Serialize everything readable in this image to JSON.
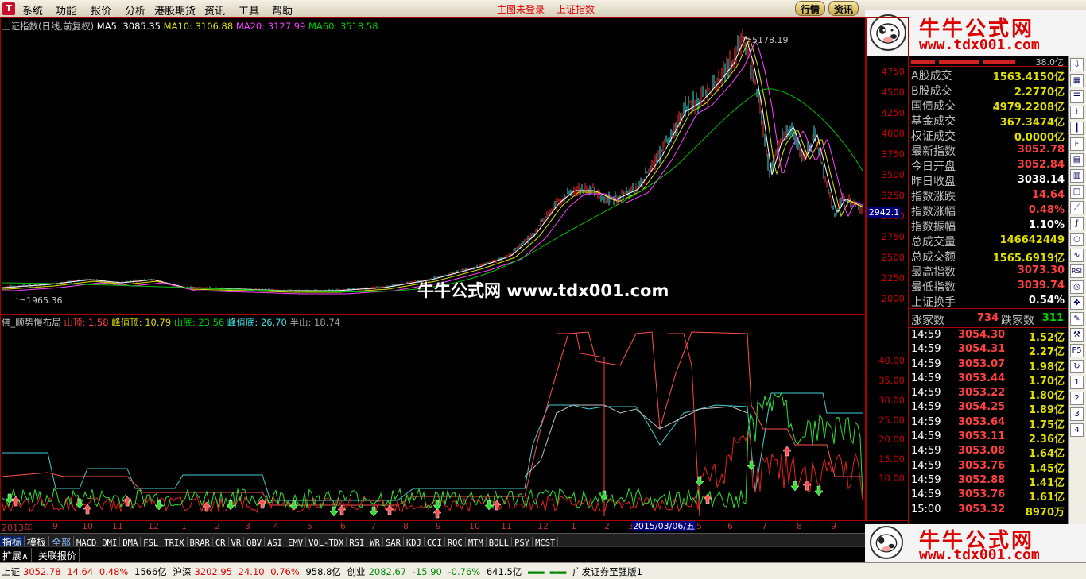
{
  "menu": [
    "系统",
    "功能",
    "报价",
    "分析",
    "港股期货",
    "资讯",
    "工具",
    "帮助"
  ],
  "center_links": [
    "主图未登录",
    "上证指数"
  ],
  "top_buttons": [
    "行情",
    "资讯"
  ],
  "brand": {
    "title": "牛牛公式网",
    "url": "www.tdx001.com"
  },
  "watermark": "牛牛公式网 www.tdx001.com",
  "chart_header": {
    "name": "上证指数(日线,前复权)",
    "ma5": "MA5: 3085.35",
    "ma10": "MA10: 3106.88",
    "ma20": "MA20: 3127.99",
    "ma60": "MA60: 3518.58"
  },
  "indicator_header": {
    "name": "佛_顺势慢布局",
    "p1": "山顶: 1.58",
    "p2": "峰值顶: 10.79",
    "p3": "山底: 23.56",
    "p4": "峰值底: 26.70",
    "p5": "半山: 18.74"
  },
  "annotations": {
    "high": "5178.19",
    "low": "1965.36",
    "current": "2942.1",
    "date": "2015/03/06/五"
  },
  "price_axis": [
    "4750",
    "4500",
    "4250",
    "4000",
    "3750",
    "3500",
    "3250",
    "3000",
    "2750",
    "2500",
    "2250",
    "2000"
  ],
  "ind_axis": [
    "40.00",
    "35.00",
    "30.00",
    "25.00",
    "20.00",
    "15.00",
    "10.00"
  ],
  "x_axis": [
    "2013年",
    "9",
    "10",
    "11",
    "12",
    "1",
    "2",
    "3",
    "4",
    "5",
    "6",
    "7",
    "8",
    "9",
    "10",
    "11",
    "12",
    "1",
    "2",
    "3",
    "5",
    "6",
    "7",
    "8",
    "9"
  ],
  "tabs_row1": [
    "指标",
    "模板",
    "全部",
    "MACD",
    "DMI",
    "DMA",
    "FSL",
    "TRIX",
    "BRAR",
    "CR",
    "VR",
    "OBV",
    "ASI",
    "EMV",
    "VOL-TDX",
    "RSI",
    "WR",
    "SAR",
    "KDJ",
    "CCI",
    "ROC",
    "MTM",
    "BOLL",
    "PSY",
    "MCST"
  ],
  "tabs_row2": [
    "扩展∧",
    "关联报价"
  ],
  "right_panel": {
    "top_value": "38.0亿",
    "stats": [
      {
        "k": "A股成交",
        "v": "1563.4150亿",
        "c": "#e0e000"
      },
      {
        "k": "B股成交",
        "v": "2.2770亿",
        "c": "#e0e000"
      },
      {
        "k": "国债成交",
        "v": "4979.2208亿",
        "c": "#e0e000"
      },
      {
        "k": "基金成交",
        "v": "367.3474亿",
        "c": "#e0e000"
      },
      {
        "k": "权证成交",
        "v": "0.0000亿",
        "c": "#e0e000"
      },
      {
        "k": "最新指数",
        "v": "3052.78",
        "c": "#ff4040"
      },
      {
        "k": "今日开盘",
        "v": "3052.84",
        "c": "#ff4040"
      },
      {
        "k": "昨日收盘",
        "v": "3038.14",
        "c": "#ffffff"
      },
      {
        "k": "指数涨跌",
        "v": "14.64",
        "c": "#ff4040"
      },
      {
        "k": "指数涨幅",
        "v": "0.48%",
        "c": "#ff4040"
      },
      {
        "k": "指数振幅",
        "v": "1.10%",
        "c": "#ffffff"
      },
      {
        "k": "总成交量",
        "v": "146642449",
        "c": "#e0e000"
      },
      {
        "k": "总成交额",
        "v": "1565.6919亿",
        "c": "#e0e000"
      },
      {
        "k": "最高指数",
        "v": "3073.30",
        "c": "#ff4040"
      },
      {
        "k": "最低指数",
        "v": "3039.74",
        "c": "#ff4040"
      },
      {
        "k": "上证换手",
        "v": "0.54%",
        "c": "#ffffff"
      }
    ],
    "updown": {
      "up_label": "涨家数",
      "up": "734",
      "down_label": "跌家数",
      "down": "311"
    },
    "trades": [
      {
        "t": "14:59",
        "p": "3054.30",
        "a": "1.52亿"
      },
      {
        "t": "14:59",
        "p": "3054.31",
        "a": "2.27亿"
      },
      {
        "t": "14:59",
        "p": "3053.07",
        "a": "1.98亿"
      },
      {
        "t": "14:59",
        "p": "3053.44",
        "a": "1.70亿"
      },
      {
        "t": "14:59",
        "p": "3053.22",
        "a": "1.80亿"
      },
      {
        "t": "14:59",
        "p": "3054.25",
        "a": "1.89亿"
      },
      {
        "t": "14:59",
        "p": "3053.64",
        "a": "1.75亿"
      },
      {
        "t": "14:59",
        "p": "3053.11",
        "a": "2.36亿"
      },
      {
        "t": "14:59",
        "p": "3053.08",
        "a": "1.64亿"
      },
      {
        "t": "14:59",
        "p": "3053.76",
        "a": "1.45亿"
      },
      {
        "t": "14:59",
        "p": "3052.88",
        "a": "1.41亿"
      },
      {
        "t": "14:59",
        "p": "3053.76",
        "a": "1.61亿"
      },
      {
        "t": "15:00",
        "p": "3053.32",
        "a": "8970万"
      }
    ]
  },
  "status": {
    "sh_label": "上证",
    "sh_val": "3052.78",
    "sh_chg": "14.64",
    "sh_pct": "0.48%",
    "sh_amt": "1566亿",
    "hs_label": "沪深",
    "hs_val": "3202.95",
    "hs_chg": "24.10",
    "hs_pct": "0.76%",
    "hs_amt": "958.8亿",
    "cy_label": "创业",
    "cy_val": "2082.67",
    "cy_chg": "-15.90",
    "cy_pct": "-0.76%",
    "cy_amt": "641.5亿",
    "broker": "广发证券至强版1"
  },
  "colors": {
    "up": "#ff4040",
    "down": "#00c000",
    "ma5": "#ffffff",
    "ma10": "#e0e000",
    "ma20": "#ff40ff",
    "ma60": "#00d000"
  }
}
